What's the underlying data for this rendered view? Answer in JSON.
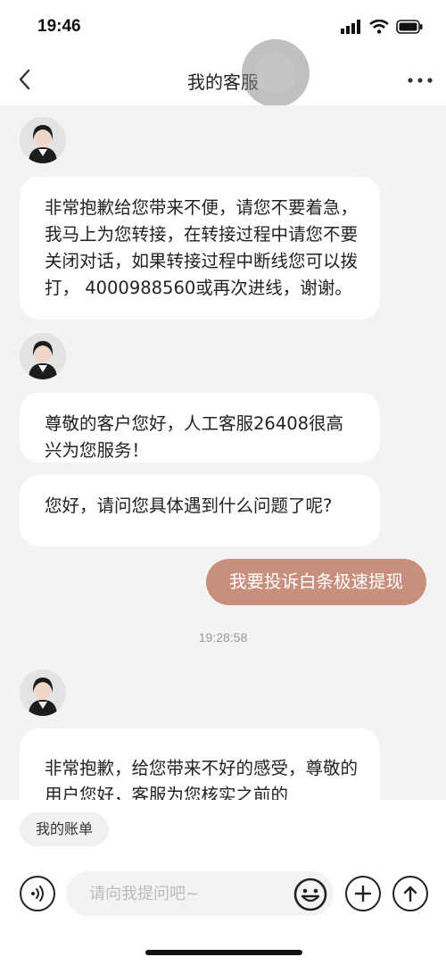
{
  "status_bar": {
    "time": "19:46"
  },
  "header": {
    "title": "我的客服"
  },
  "messages": [
    {
      "from": "agent",
      "text": "非常抱歉给您带来不便，请您不要着急，我马上为您转接，在转接过程中请您不要关闭对话，如果转接过程中断线您可以拨打， 4000988560或再次进线，谢谢。"
    },
    {
      "from": "agent",
      "text": "尊敬的客户您好，人工客服26408很高兴为您服务！"
    },
    {
      "from": "agent",
      "text": "您好，请问您具体遇到什么问题了呢?"
    },
    {
      "from": "user",
      "text": "我要投诉白条极速提现"
    },
    {
      "from": "agent",
      "text": "非常抱歉，给您带来不好的感受，尊敬的用户您好，客服为您核实之前的"
    }
  ],
  "timestamp": "19:28:58",
  "quick_reply": "我的账单",
  "input": {
    "placeholder": "请向我提问吧~"
  },
  "colors": {
    "user_bubble": "#c98f7d",
    "chat_bg": "#f3f3f5"
  }
}
